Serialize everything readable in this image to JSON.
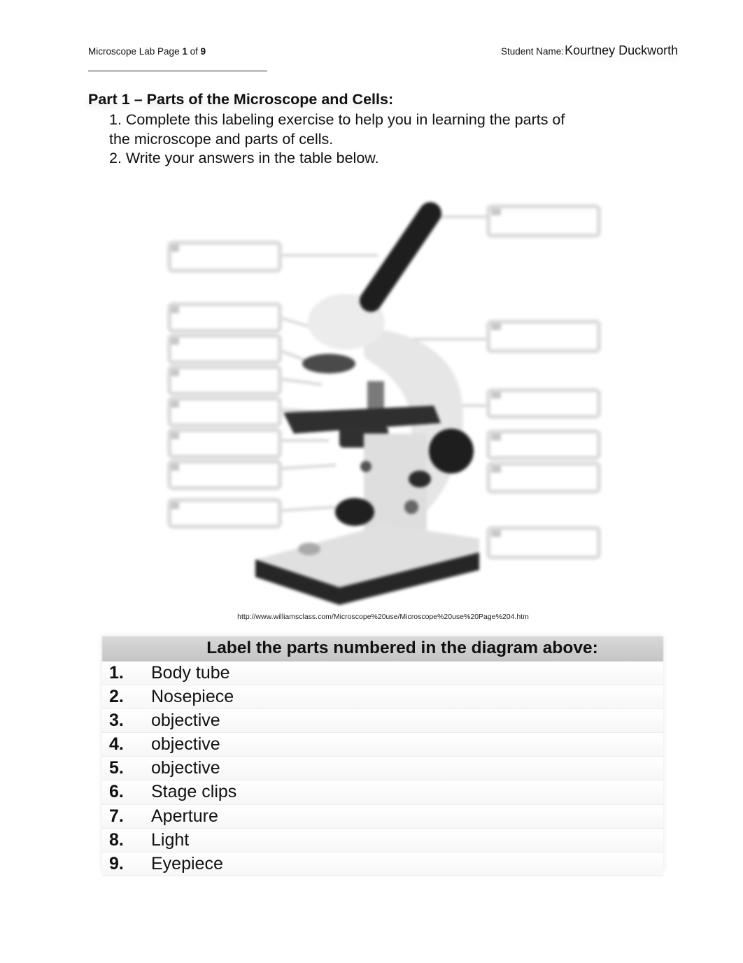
{
  "header": {
    "doc_title_prefix": "Microscope Lab Page ",
    "page_current": "1",
    "page_sep": " of ",
    "page_total": "9",
    "student_label": "Student Name:",
    "student_name": "Kourtney Duckworth"
  },
  "part": {
    "title": "Part 1 –  Parts of the Microscope and Cells:",
    "instructions": [
      "1.  Complete this labeling exercise to help you in learning the parts of",
      "the microscope and parts of cells.",
      "2.  Write your answers in the table below."
    ]
  },
  "diagram": {
    "label_boxes_left_count": 8,
    "label_boxes_right_count": 6,
    "source_url": "http://www.williamsclass.com/Microscope%20use/Microscope%20use%20Page%204.htm"
  },
  "answers": {
    "title": "Label the parts numbered in the diagram above:",
    "rows": [
      {
        "num": "1.",
        "answer": "Body tube"
      },
      {
        "num": "2.",
        "answer": "Nosepiece"
      },
      {
        "num": "3.",
        "answer": "objective"
      },
      {
        "num": "4.",
        "answer": "objective"
      },
      {
        "num": "5.",
        "answer": "objective"
      },
      {
        "num": "6.",
        "answer": "Stage clips"
      },
      {
        "num": "7.",
        "answer": "Aperture"
      },
      {
        "num": "8.",
        "answer": "Light"
      },
      {
        "num": "9.",
        "answer": "Eyepiece"
      }
    ]
  }
}
